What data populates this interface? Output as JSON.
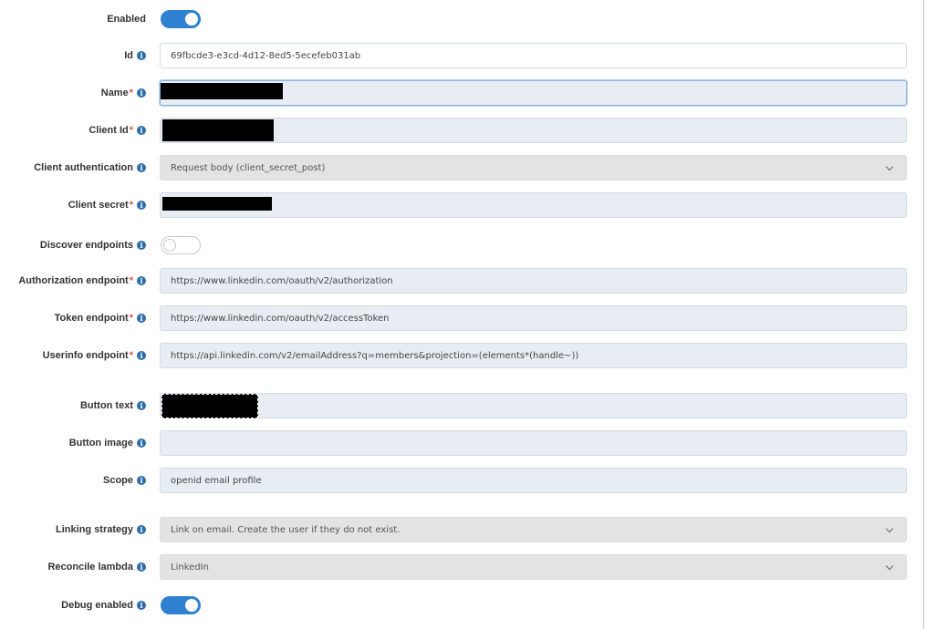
{
  "form": {
    "enabled": {
      "label": "Enabled",
      "value": true
    },
    "id": {
      "label": "Id",
      "value": "69fbcde3-e3cd-4d12-8ed5-5ecefeb031ab"
    },
    "name": {
      "label": "Name",
      "required": "*",
      "value": ""
    },
    "client_id": {
      "label": "Client Id",
      "required": "*",
      "value": ""
    },
    "client_authentication": {
      "label": "Client authentication",
      "value": "Request body (client_secret_post)"
    },
    "client_secret": {
      "label": "Client secret",
      "required": "*",
      "value": ""
    },
    "discover_endpoints": {
      "label": "Discover endpoints",
      "value": false
    },
    "authorization_endpoint": {
      "label": "Authorization endpoint",
      "required": "*",
      "value": "https://www.linkedin.com/oauth/v2/authorization"
    },
    "token_endpoint": {
      "label": "Token endpoint",
      "required": "*",
      "value": "https://www.linkedin.com/oauth/v2/accessToken"
    },
    "userinfo_endpoint": {
      "label": "Userinfo endpoint",
      "required": "*",
      "value": "https://api.linkedin.com/v2/emailAddress?q=members&projection=(elements*(handle~))"
    },
    "button_text": {
      "label": "Button text",
      "value": ""
    },
    "button_image": {
      "label": "Button image",
      "value": ""
    },
    "scope": {
      "label": "Scope",
      "value": "openid email profile"
    },
    "linking_strategy": {
      "label": "Linking strategy",
      "value": "Link on email. Create the user if they do not exist."
    },
    "reconcile_lambda": {
      "label": "Reconcile lambda",
      "value": "LinkedIn"
    },
    "debug_enabled": {
      "label": "Debug enabled",
      "value": true
    }
  },
  "icons": {
    "info": "info-icon",
    "dropdown": "chevron-down-icon"
  },
  "colors": {
    "accent": "#2f80d1",
    "required": "#d9534f",
    "info": "#2d6ea8"
  }
}
